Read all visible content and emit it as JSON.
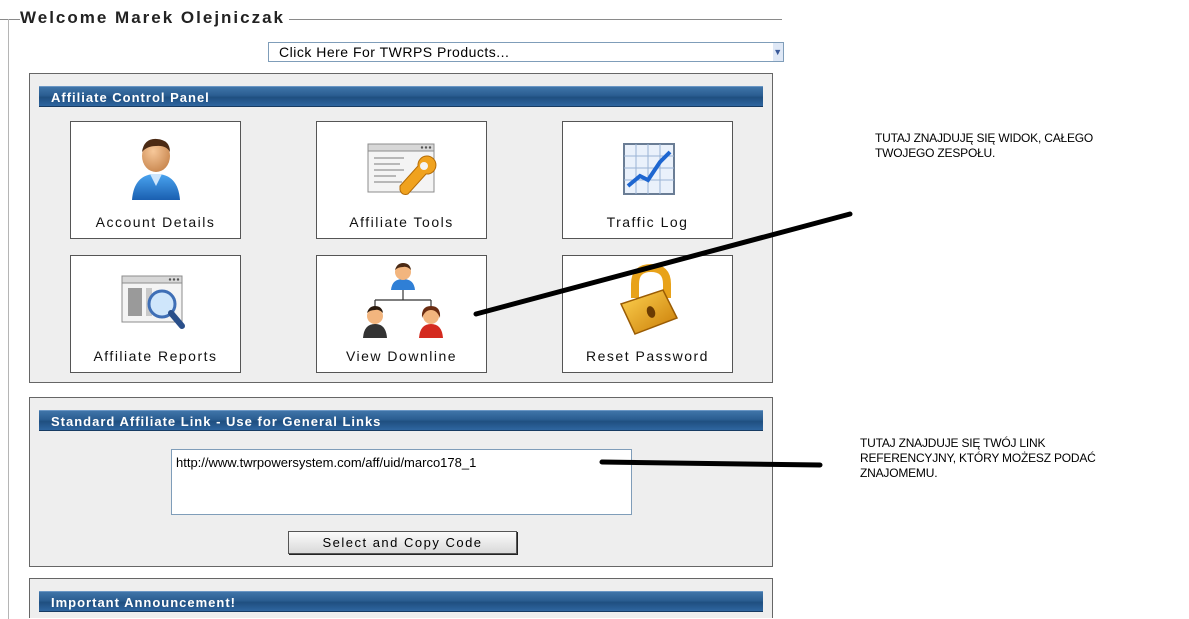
{
  "header": {
    "welcome": "Welcome Marek Olejniczak",
    "products_select": "Click Here For TWRPS Products..."
  },
  "control_panel": {
    "title": "Affiliate Control Panel",
    "tiles": [
      {
        "label": "Account Details",
        "icon": "user-icon"
      },
      {
        "label": "Affiliate Tools",
        "icon": "tools-icon"
      },
      {
        "label": "Traffic Log",
        "icon": "chart-icon"
      },
      {
        "label": "Affiliate Reports",
        "icon": "reports-icon"
      },
      {
        "label": "View Downline",
        "icon": "downline-icon"
      },
      {
        "label": "Reset Password",
        "icon": "lock-icon"
      }
    ]
  },
  "affiliate_link": {
    "title": "Standard Affiliate Link - Use for General Links",
    "url": "http://www.twrpowersystem.com/aff/uid/marco178_1",
    "copy_button": "Select and Copy Code"
  },
  "announcement": {
    "title": "Important Announcement!"
  },
  "annotations": {
    "downline_note_line1": "TUTAJ ZNAJDUJĘ SIĘ WIDOK, CAŁEGO",
    "downline_note_line2": "TWOJEGO ZESPOŁU.",
    "link_note_line1": "TUTAJ ZNAJDUJE SIĘ TWÓJ LINK",
    "link_note_line2": "REFERENCYJNY, KTÓRY MOŻESZ PODAĆ",
    "link_note_line3": "ZNAJOMEMU."
  }
}
